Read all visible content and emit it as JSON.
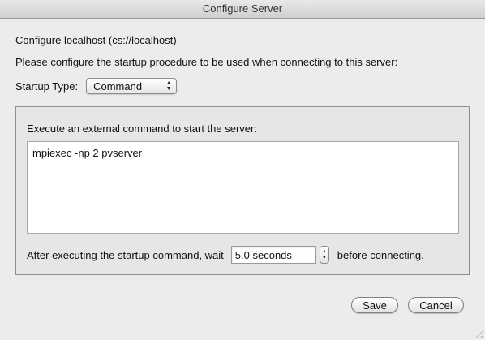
{
  "window": {
    "title": "Configure Server"
  },
  "header": {
    "configure_line": "Configure localhost (cs://localhost)",
    "instruction": "Please configure the startup procedure to be used when connecting to this server:"
  },
  "startup": {
    "label": "Startup Type:",
    "selected": "Command"
  },
  "command_group": {
    "label": "Execute an external command to start the server:",
    "command": "mpiexec -np 2 pvserver",
    "wait_label": "After executing the startup command, wait",
    "wait_value": "5.0 seconds",
    "after_label": "before connecting."
  },
  "buttons": {
    "save": "Save",
    "cancel": "Cancel"
  }
}
